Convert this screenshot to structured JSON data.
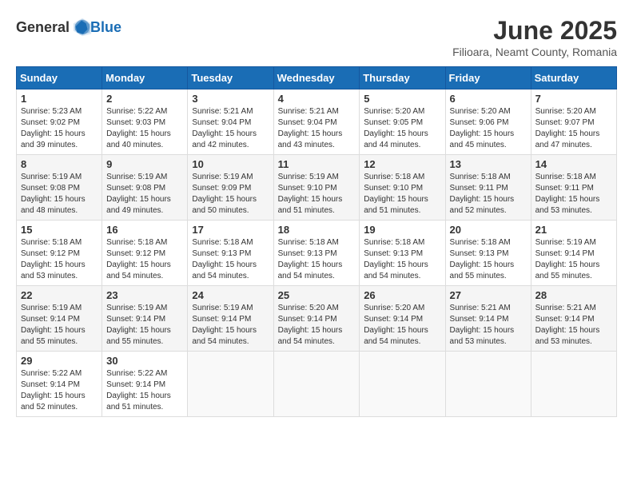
{
  "header": {
    "logo_general": "General",
    "logo_blue": "Blue",
    "month_title": "June 2025",
    "location": "Filioara, Neamt County, Romania"
  },
  "calendar": {
    "headers": [
      "Sunday",
      "Monday",
      "Tuesday",
      "Wednesday",
      "Thursday",
      "Friday",
      "Saturday"
    ],
    "weeks": [
      [
        {
          "day": "1",
          "info": "Sunrise: 5:23 AM\nSunset: 9:02 PM\nDaylight: 15 hours\nand 39 minutes."
        },
        {
          "day": "2",
          "info": "Sunrise: 5:22 AM\nSunset: 9:03 PM\nDaylight: 15 hours\nand 40 minutes."
        },
        {
          "day": "3",
          "info": "Sunrise: 5:21 AM\nSunset: 9:04 PM\nDaylight: 15 hours\nand 42 minutes."
        },
        {
          "day": "4",
          "info": "Sunrise: 5:21 AM\nSunset: 9:04 PM\nDaylight: 15 hours\nand 43 minutes."
        },
        {
          "day": "5",
          "info": "Sunrise: 5:20 AM\nSunset: 9:05 PM\nDaylight: 15 hours\nand 44 minutes."
        },
        {
          "day": "6",
          "info": "Sunrise: 5:20 AM\nSunset: 9:06 PM\nDaylight: 15 hours\nand 45 minutes."
        },
        {
          "day": "7",
          "info": "Sunrise: 5:20 AM\nSunset: 9:07 PM\nDaylight: 15 hours\nand 47 minutes."
        }
      ],
      [
        {
          "day": "8",
          "info": "Sunrise: 5:19 AM\nSunset: 9:08 PM\nDaylight: 15 hours\nand 48 minutes."
        },
        {
          "day": "9",
          "info": "Sunrise: 5:19 AM\nSunset: 9:08 PM\nDaylight: 15 hours\nand 49 minutes."
        },
        {
          "day": "10",
          "info": "Sunrise: 5:19 AM\nSunset: 9:09 PM\nDaylight: 15 hours\nand 50 minutes."
        },
        {
          "day": "11",
          "info": "Sunrise: 5:19 AM\nSunset: 9:10 PM\nDaylight: 15 hours\nand 51 minutes."
        },
        {
          "day": "12",
          "info": "Sunrise: 5:18 AM\nSunset: 9:10 PM\nDaylight: 15 hours\nand 51 minutes."
        },
        {
          "day": "13",
          "info": "Sunrise: 5:18 AM\nSunset: 9:11 PM\nDaylight: 15 hours\nand 52 minutes."
        },
        {
          "day": "14",
          "info": "Sunrise: 5:18 AM\nSunset: 9:11 PM\nDaylight: 15 hours\nand 53 minutes."
        }
      ],
      [
        {
          "day": "15",
          "info": "Sunrise: 5:18 AM\nSunset: 9:12 PM\nDaylight: 15 hours\nand 53 minutes."
        },
        {
          "day": "16",
          "info": "Sunrise: 5:18 AM\nSunset: 9:12 PM\nDaylight: 15 hours\nand 54 minutes."
        },
        {
          "day": "17",
          "info": "Sunrise: 5:18 AM\nSunset: 9:13 PM\nDaylight: 15 hours\nand 54 minutes."
        },
        {
          "day": "18",
          "info": "Sunrise: 5:18 AM\nSunset: 9:13 PM\nDaylight: 15 hours\nand 54 minutes."
        },
        {
          "day": "19",
          "info": "Sunrise: 5:18 AM\nSunset: 9:13 PM\nDaylight: 15 hours\nand 54 minutes."
        },
        {
          "day": "20",
          "info": "Sunrise: 5:18 AM\nSunset: 9:13 PM\nDaylight: 15 hours\nand 55 minutes."
        },
        {
          "day": "21",
          "info": "Sunrise: 5:19 AM\nSunset: 9:14 PM\nDaylight: 15 hours\nand 55 minutes."
        }
      ],
      [
        {
          "day": "22",
          "info": "Sunrise: 5:19 AM\nSunset: 9:14 PM\nDaylight: 15 hours\nand 55 minutes."
        },
        {
          "day": "23",
          "info": "Sunrise: 5:19 AM\nSunset: 9:14 PM\nDaylight: 15 hours\nand 55 minutes."
        },
        {
          "day": "24",
          "info": "Sunrise: 5:19 AM\nSunset: 9:14 PM\nDaylight: 15 hours\nand 54 minutes."
        },
        {
          "day": "25",
          "info": "Sunrise: 5:20 AM\nSunset: 9:14 PM\nDaylight: 15 hours\nand 54 minutes."
        },
        {
          "day": "26",
          "info": "Sunrise: 5:20 AM\nSunset: 9:14 PM\nDaylight: 15 hours\nand 54 minutes."
        },
        {
          "day": "27",
          "info": "Sunrise: 5:21 AM\nSunset: 9:14 PM\nDaylight: 15 hours\nand 53 minutes."
        },
        {
          "day": "28",
          "info": "Sunrise: 5:21 AM\nSunset: 9:14 PM\nDaylight: 15 hours\nand 53 minutes."
        }
      ],
      [
        {
          "day": "29",
          "info": "Sunrise: 5:22 AM\nSunset: 9:14 PM\nDaylight: 15 hours\nand 52 minutes."
        },
        {
          "day": "30",
          "info": "Sunrise: 5:22 AM\nSunset: 9:14 PM\nDaylight: 15 hours\nand 51 minutes."
        },
        {
          "day": "",
          "info": ""
        },
        {
          "day": "",
          "info": ""
        },
        {
          "day": "",
          "info": ""
        },
        {
          "day": "",
          "info": ""
        },
        {
          "day": "",
          "info": ""
        }
      ]
    ]
  }
}
